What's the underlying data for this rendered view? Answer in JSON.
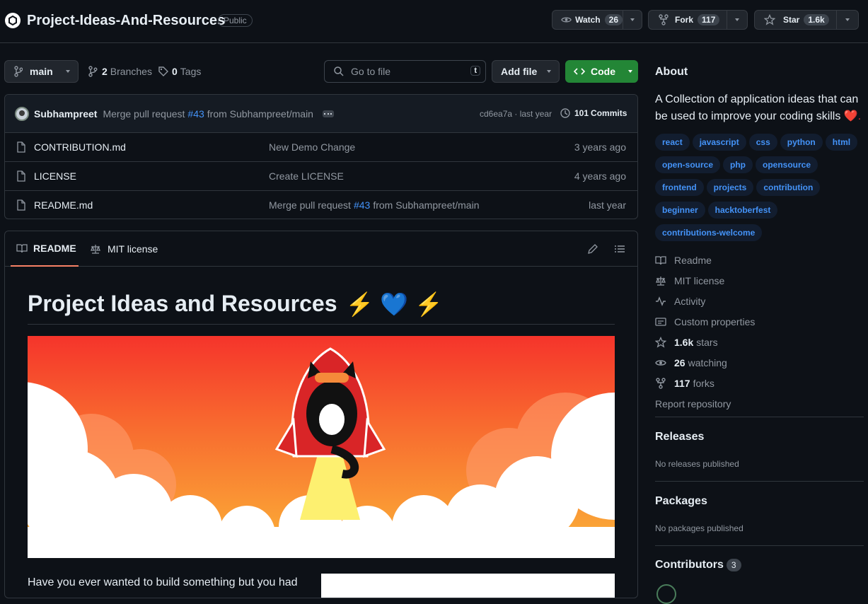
{
  "repo": {
    "name": "Project-Ideas-And-Resources",
    "visibility": "Public"
  },
  "actions": {
    "watch": {
      "label": "Watch",
      "count": "26"
    },
    "fork": {
      "label": "Fork",
      "count": "117"
    },
    "star": {
      "label": "Star",
      "count": "1.6k"
    }
  },
  "toolbar": {
    "branch": "main",
    "branches_count": "2",
    "branches_label": "Branches",
    "tags_count": "0",
    "tags_label": "Tags",
    "goto_placeholder": "Go to file",
    "goto_key": "t",
    "add_file": "Add file",
    "code": "Code"
  },
  "commit": {
    "author": "Subhampreet",
    "message_prefix": "Merge pull request",
    "pr": "#43",
    "message_suffix": "from Subhampreet/main",
    "sha_time": "cd6ea7a · last year",
    "commits_count": "101",
    "commits_label": "Commits"
  },
  "files": [
    {
      "name": "CONTRIBUTION.md",
      "message": "New Demo Change",
      "pr": "",
      "suffix": "",
      "time": "3 years ago"
    },
    {
      "name": "LICENSE",
      "message": "Create LICENSE",
      "pr": "",
      "suffix": "",
      "time": "4 years ago"
    },
    {
      "name": "README.md",
      "message": "Merge pull request",
      "pr": "#43",
      "suffix": "from Subhampreet/main",
      "time": "last year"
    }
  ],
  "readme": {
    "tab_readme": "README",
    "tab_license": "MIT license",
    "title": "Project Ideas and Resources",
    "title_emoji": "⚡ 💙 ⚡",
    "intro": "Have you ever wanted to build something but you had"
  },
  "about": {
    "heading": "About",
    "description": "A Collection of application ideas that can be used to improve your coding skills",
    "heart": "❤️.",
    "topics": [
      "react",
      "javascript",
      "css",
      "python",
      "html",
      "open-source",
      "php",
      "opensource",
      "frontend",
      "projects",
      "contribution",
      "beginner",
      "hacktoberfest",
      "contributions-welcome"
    ],
    "links": {
      "readme": "Readme",
      "license": "MIT license",
      "activity": "Activity",
      "custom": "Custom properties",
      "stars_count": "1.6k",
      "stars_label": "stars",
      "watching_count": "26",
      "watching_label": "watching",
      "forks_count": "117",
      "forks_label": "forks",
      "report": "Report repository"
    }
  },
  "releases": {
    "heading": "Releases",
    "text": "No releases published"
  },
  "packages": {
    "heading": "Packages",
    "text": "No packages published"
  },
  "contributors": {
    "heading": "Contributors",
    "count": "3"
  },
  "colors": {
    "accent": "#4493f8",
    "code_button": "#238636",
    "bg": "#0d1117",
    "border": "#30363d"
  }
}
